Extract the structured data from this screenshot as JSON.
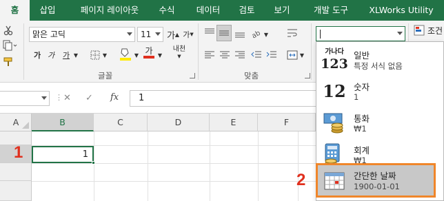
{
  "ribbon_tabs": [
    "홈",
    "삽입",
    "페이지 레이아웃",
    "수식",
    "데이터",
    "검토",
    "보기",
    "개발 도구",
    "XLWorks Utility"
  ],
  "font": {
    "name": "맑은 고딕",
    "size": "11",
    "grow_label": "가",
    "shrink_label": "가",
    "bold_label": "가",
    "italic_label": "가",
    "underline_label": "가",
    "font_color_label": "가",
    "phonetic_label": "내천",
    "group_label": "글꼴"
  },
  "alignment": {
    "group_label": "맞춤"
  },
  "number_format": {
    "current_value": "",
    "conditional_label": "조건"
  },
  "formula_bar": {
    "name_box": "",
    "cancel_label": "✕",
    "enter_label": "✓",
    "fx_label": "fx",
    "formula_value": "1"
  },
  "grid": {
    "columns": [
      "A",
      "B",
      "C",
      "D",
      "E",
      "F"
    ],
    "selected_column": "B",
    "cell_b2_value": "1"
  },
  "format_dropdown": {
    "items": [
      {
        "name": "일반",
        "sample": "특정 서식 없음",
        "icon_top": "가나다",
        "icon_bottom": "123"
      },
      {
        "name": "숫자",
        "sample": "1",
        "icon_text": "12"
      },
      {
        "name": "통화",
        "sample": "₩1"
      },
      {
        "name": "회계",
        "sample": "₩1"
      },
      {
        "name": "간단한 날짜",
        "sample": "1900-01-01"
      }
    ],
    "highlight_color": "#f0862a"
  },
  "annotations": {
    "step_1": "1",
    "step_2": "2",
    "color": "#e0301e"
  },
  "colors": {
    "excel_green": "#217346",
    "ribbon_bg": "#f3f3f3"
  }
}
